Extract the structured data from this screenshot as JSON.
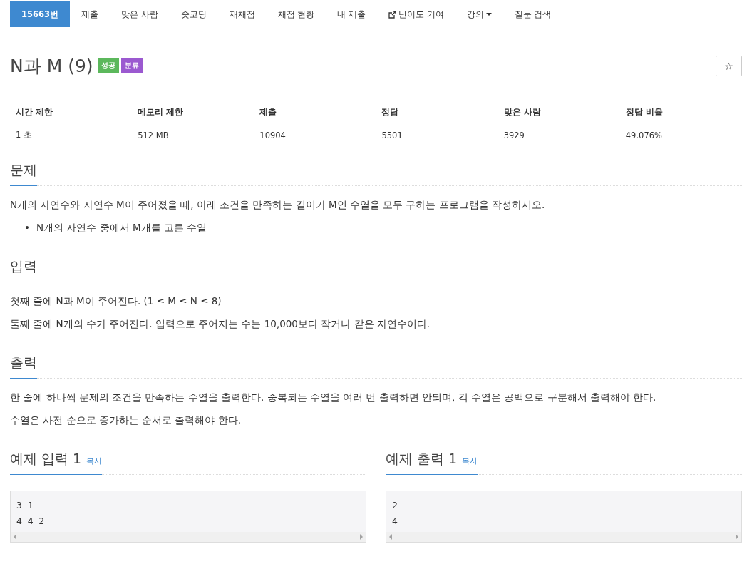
{
  "nav": {
    "items": [
      {
        "label": "15663번",
        "kind": "plain",
        "selected": true
      },
      {
        "label": "제출",
        "kind": "plain",
        "selected": false
      },
      {
        "label": "맞은 사람",
        "kind": "plain",
        "selected": false
      },
      {
        "label": "숏코딩",
        "kind": "plain",
        "selected": false
      },
      {
        "label": "재채점",
        "kind": "plain",
        "selected": false
      },
      {
        "label": "채점 현황",
        "kind": "plain",
        "selected": false
      },
      {
        "label": "내 제출",
        "kind": "plain",
        "selected": false
      },
      {
        "label": "난이도 기여",
        "kind": "external",
        "selected": false
      },
      {
        "label": "강의",
        "kind": "dropdown",
        "selected": false
      },
      {
        "label": "질문 검색",
        "kind": "plain",
        "selected": false
      }
    ]
  },
  "problem": {
    "title": "N과 M (9)",
    "badges": [
      {
        "label": "성공",
        "color": "#5cb85c"
      },
      {
        "label": "분류",
        "color": "#9b59d0"
      }
    ],
    "star_button": "☆"
  },
  "stats": {
    "columns": [
      "시간 제한",
      "메모리 제한",
      "제출",
      "정답",
      "맞은 사람",
      "정답 비율"
    ],
    "rows": [
      [
        "1 초",
        "512 MB",
        "10904",
        "5501",
        "3929",
        "49.076%"
      ]
    ]
  },
  "sections": [
    {
      "heading": "문제",
      "blocks": [
        {
          "kind": "paragraph",
          "text": "N개의 자연수와 자연수 M이 주어졌을 때, 아래 조건을 만족하는 길이가 M인 수열을 모두 구하는 프로그램을 작성하시오."
        },
        {
          "kind": "list",
          "items": [
            {
              "marker": "•",
              "text": "N개의 자연수 중에서 M개를 고른 수열"
            }
          ]
        }
      ]
    },
    {
      "heading": "입력",
      "blocks": [
        {
          "kind": "paragraph",
          "text": "첫째 줄에 N과 M이 주어진다. (1 ≤ M ≤ N ≤ 8)"
        },
        {
          "kind": "paragraph",
          "text": "둘째 줄에 N개의 수가 주어진다. 입력으로 주어지는 수는 10,000보다 작거나 같은 자연수이다."
        }
      ]
    },
    {
      "heading": "출력",
      "blocks": [
        {
          "kind": "paragraph",
          "text": "한 줄에 하나씩 문제의 조건을 만족하는 수열을 출력한다. 중복되는 수열을 여러 번 출력하면 안되며, 각 수열은 공백으로 구분해서 출력해야 한다."
        },
        {
          "kind": "paragraph",
          "text": "수열은 사전 순으로 증가하는 순서로 출력해야 한다."
        }
      ]
    }
  ],
  "samples": [
    {
      "heading": "예제 입력 1",
      "copy_label": "복사",
      "lines": [
        "3 1",
        "4 4 2"
      ]
    },
    {
      "heading": "예제 출력 1",
      "copy_label": "복사",
      "lines": [
        "2",
        "4"
      ]
    }
  ]
}
